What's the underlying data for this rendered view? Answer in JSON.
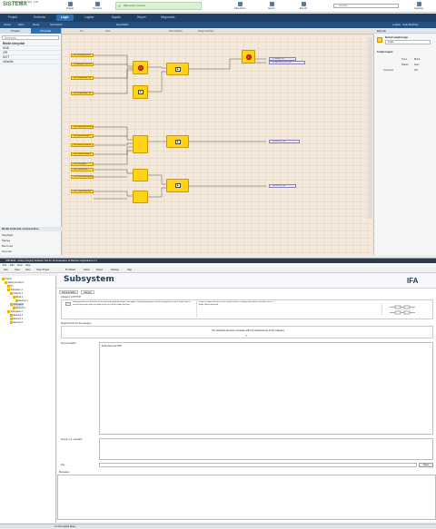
{
  "app": {
    "title": "sistemaPLCintellij - 1.00",
    "logo": "SISTEMA"
  },
  "ribbon": {
    "items": [
      "Projekt",
      "Tervezés",
      "Ellenőrzés",
      "Export",
      "Elemző"
    ],
    "banner": "Sikeresen mentve",
    "search_placeholder": "Keresés",
    "right_items": [
      "Segítség",
      "Névjegy"
    ]
  },
  "nav": {
    "tabs": [
      "Projekt",
      "Erőforrás",
      "Logic",
      "Logikai",
      "Naplók",
      "Report",
      "Megosztás"
    ],
    "active": "Logic"
  },
  "sub": {
    "items": [
      "Vissza",
      "Előre",
      "Nézet",
      "Szimuláció",
      "Exportálás"
    ],
    "right": "Logikai - Safe Machine"
  },
  "left_panel": {
    "tabs": [
      "Projekt",
      "Könyvtár"
    ],
    "search": "Keresés...",
    "section": "Blokk könyvtár",
    "rows": [
      "AND",
      "OR",
      "NOT",
      "Időzítők",
      "Számlálók",
      "Bemenetek",
      "Kimenetek"
    ],
    "bottom_section": "Blokk funkciók szerkesztése",
    "bottom_rows": [
      "Meghajtó",
      "Mérleg",
      "Bemenet",
      "Kimenet"
    ]
  },
  "canvas": {
    "tabs": [
      "Fő",
      "Sub",
      "Szimuláció",
      "Diagnosztika"
    ],
    "inputs": [
      "IN1 Vészleállító gomb",
      "IN2 Ajtófigyelő kapcsoló",
      "IN3 Fénysorompó CH1",
      "IN4 Fénysorompó CH2",
      "IN5 Hőmérséklet érzékelő",
      "IN6 Nyomásérzékelő",
      "IN7 Kétkezes kezelő A",
      "IN8 Kétkezes kezelő B",
      "IN9 Reset gomb",
      "IN10 Zárszerkezet",
      "IN11 Biztonsági szőnyeg",
      "IN12 Végálláskapcsoló"
    ],
    "outputs": [
      "Q1 Safety_Out",
      "Q2 MOTOR_STOP_OUT",
      "Q3 OUTPUT_03",
      "Q4 OUTPUT_04"
    ],
    "gate_labels": [
      "AND",
      "&",
      "&",
      "&",
      "&"
    ]
  },
  "right_panel": {
    "title": "Elemek",
    "field1": "Elemek tulajdonsága",
    "field_value": "Logic",
    "section": "Tulajdonságok",
    "props": [
      [
        "Típus",
        "Blokk"
      ],
      [
        "Állapot",
        "Aktív"
      ],
      [
        "Azonosító",
        "007"
      ]
    ]
  },
  "lower": {
    "title": "SISTEMA - Safety Integrity Software Tool for the Evaluation of Machine Applications 2.0",
    "menu": [
      "File",
      "Edit",
      "View",
      "Help"
    ],
    "toolbar": [
      "New",
      "Open",
      "Save",
      "Close Project",
      "PL Wizard",
      "Check",
      "Report",
      "Settings",
      "Help"
    ],
    "tree": [
      "Project",
      "Safety Function 1",
      "PL",
      "Subsystem 1",
      "Channel 1",
      "Block 1",
      "Element 1",
      "Subsystem",
      "Element 2",
      "Subsystem 2",
      "Element 3",
      "Element 4",
      "Element 5"
    ],
    "subsystem_title": "Subsystem",
    "tabs": [
      "Documentation",
      "Category"
    ],
    "sub_tab": "Category & MTTFD",
    "cat_text": "Requirements of B and the use of well-tried safety principles shall apply. Safety-related parts shall be designed so that a single fault in any of these parts does not lead to the loss of the safety function...",
    "cat_text2": "When a single fault occurs the safety function is always performed. However, not all faults will be detected.",
    "req_label": "Requirements for the category",
    "req_text": "The selected structure complies with the requirements of the category",
    "doc_label": "Documentation",
    "doc_text": "Field name test PFH",
    "ref_label": "Source e.g. standard",
    "file_label": "File",
    "open_btn": "Open",
    "messages": "Messages",
    "status": "2.0 Test default library"
  },
  "ifa": "IFA"
}
